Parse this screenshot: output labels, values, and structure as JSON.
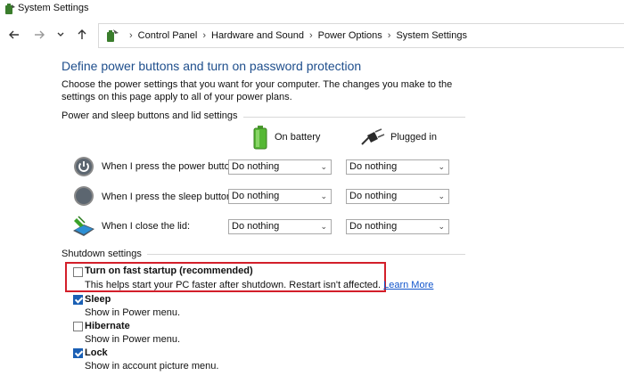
{
  "window": {
    "title": "System Settings"
  },
  "breadcrumb": [
    "Control Panel",
    "Hardware and Sound",
    "Power Options",
    "System Settings"
  ],
  "page": {
    "heading": "Define power buttons and turn on password protection",
    "intro": "Choose the power settings that you want for your computer. The changes you make to the settings on this page apply to all of your power plans."
  },
  "power_section": {
    "label": "Power and sleep buttons and lid settings",
    "col_battery": "On battery",
    "col_plugged": "Plugged in",
    "rows": [
      {
        "label": "When I press the power button:",
        "battery": "Do nothing",
        "plugged": "Do nothing"
      },
      {
        "label": "When I press the sleep button:",
        "battery": "Do nothing",
        "plugged": "Do nothing"
      },
      {
        "label": "When I close the lid:",
        "battery": "Do nothing",
        "plugged": "Do nothing"
      }
    ]
  },
  "shutdown_section": {
    "label": "Shutdown settings",
    "options": [
      {
        "title": "Turn on fast startup (recommended)",
        "desc": "This helps start your PC faster after shutdown. Restart isn't affected.",
        "link": "Learn More",
        "checked": false
      },
      {
        "title": "Sleep",
        "desc": "Show in Power menu.",
        "checked": true
      },
      {
        "title": "Hibernate",
        "desc": "Show in Power menu.",
        "checked": false
      },
      {
        "title": "Lock",
        "desc": "Show in account picture menu.",
        "checked": true
      }
    ]
  },
  "colors": {
    "heading": "#1e4e8c",
    "highlight": "#d31f2a",
    "checkbox": "#1a5fb4",
    "link": "#1155cc"
  },
  "icons": {
    "title": "power-options-icon",
    "back": "arrow-left-icon",
    "forward": "arrow-right-icon",
    "recent": "chevron-down-icon",
    "up": "arrow-up-icon",
    "battery": "battery-icon",
    "plug": "plug-icon",
    "power_button": "power-button-icon",
    "sleep_button": "sleep-button-icon",
    "lid": "laptop-lid-icon"
  }
}
